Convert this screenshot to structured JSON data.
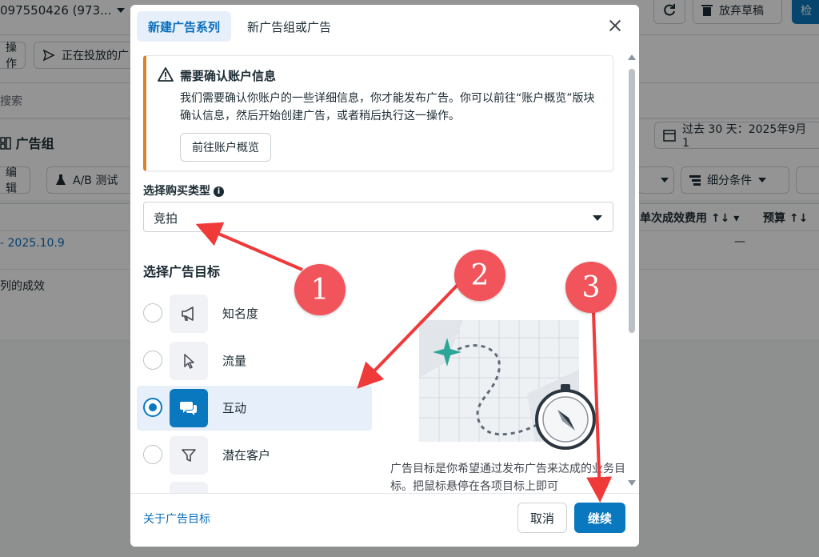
{
  "background": {
    "account": "097550426 (973...",
    "toolbar_refresh_icon": "refresh-icon",
    "discard_draft": "放弃草稿",
    "check_button": "检",
    "ops_label": "操作",
    "running_label": "正在投放的广",
    "search_placeholder": "搜索",
    "section_title": "广告组",
    "date_range": "过去 30 天：2025年9月1",
    "edit_label": "编辑",
    "ab_test": "A/B 测试",
    "breakdown": "细分条件",
    "col_cost": "单次成效费用",
    "col_budget": "预算",
    "row_date": "- 2025.10.9",
    "row_dash": "—",
    "row_results": "列的成效"
  },
  "modal": {
    "tabs": [
      {
        "label": "新建广告系列",
        "active": true
      },
      {
        "label": "新广告组或广告",
        "active": false
      }
    ],
    "alert": {
      "title": "需要确认账户信息",
      "body": "我们需要确认你账户的一些详细信息，你才能发布广告。你可以前往“账户概览”版块确认信息，然后开始创建广告，或者稍后执行这一操作。",
      "button": "前往账户概览"
    },
    "buy_type": {
      "label": "选择购买类型",
      "value": "竞拍"
    },
    "objective": {
      "title": "选择广告目标",
      "options": [
        {
          "label": "知名度",
          "icon": "megaphone-icon",
          "selected": false
        },
        {
          "label": "流量",
          "icon": "cursor-icon",
          "selected": false
        },
        {
          "label": "互动",
          "icon": "chat-bubbles-icon",
          "selected": true
        },
        {
          "label": "潜在客户",
          "icon": "filter-icon",
          "selected": false
        }
      ],
      "description": "广告目标是你希望通过发布广告来达成的业务目标。把鼠标悬停在各项目标上即可"
    },
    "footer": {
      "link": "关于广告目标",
      "cancel": "取消",
      "continue": "继续"
    }
  },
  "annotations": {
    "badges": [
      "1",
      "2",
      "3"
    ],
    "color": "#f2545b"
  },
  "colors": {
    "accent": "#0a78be",
    "warning": "#d9822b"
  }
}
